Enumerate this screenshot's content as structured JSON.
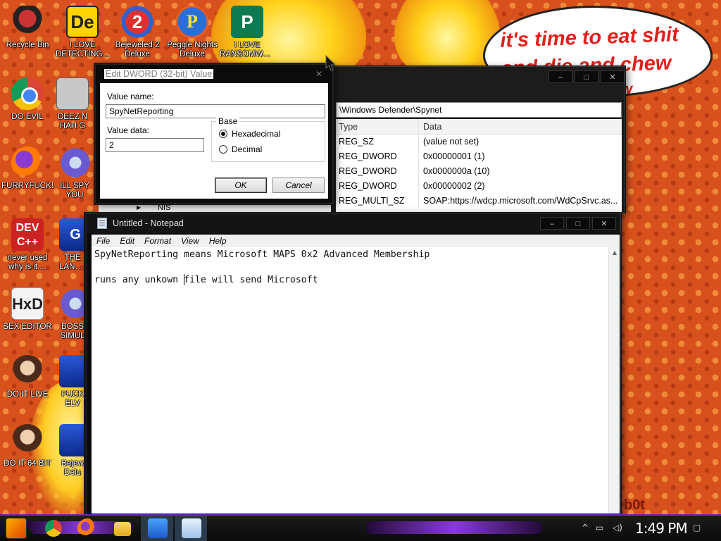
{
  "wallpaper": {
    "speech_bubble": "it's time to eat shit and die and chew",
    "bubble_tail_text": "w",
    "corner_tag": "b0t"
  },
  "desktop_icons": [
    {
      "label": "Recycle Bin",
      "icon": "recycle-bin-icon"
    },
    {
      "label": "I LOVE DETECTING...",
      "icon": "detect-it-easy-icon"
    },
    {
      "label": "Bejeweled 2 Deluxe",
      "icon": "bejeweled-icon"
    },
    {
      "label": "Peggle Nights Deluxe",
      "icon": "peggle-icon"
    },
    {
      "label": "I LOVE RANSOMWARE",
      "icon": "publisher-icon"
    },
    {
      "label": "DO EVIL",
      "icon": "chrome-icon"
    },
    {
      "label": "DEEZ N HAH G",
      "icon": "blank-file-icon"
    },
    {
      "label": "FURRYFUCK!",
      "icon": "firefox-icon"
    },
    {
      "label": "ILL SPY YOU",
      "icon": "gear-icon"
    },
    {
      "label": "never used why is it ...",
      "icon": "devcpp-icon"
    },
    {
      "label": "THE LANGUA",
      "icon": "go-icon"
    },
    {
      "label": "SEX EDITOR",
      "icon": "hxd-icon"
    },
    {
      "label": "BOSS SIMUL",
      "icon": "gear-icon"
    },
    {
      "label": "DO IT LIVE",
      "icon": "portrait-icon"
    },
    {
      "label": "FUCK ELV",
      "icon": "blue-app-icon"
    },
    {
      "label": "DO IT 64 BIT",
      "icon": "portrait-64-icon"
    },
    {
      "label": "Bejew Delu",
      "icon": "bejeweled-blue-icon"
    }
  ],
  "registry_editor": {
    "path": "\\Windows Defender\\Spynet",
    "columns": [
      "Type",
      "Data"
    ],
    "rows": [
      {
        "type": "REG_SZ",
        "data": "(value not set)"
      },
      {
        "type": "REG_DWORD",
        "data": "0x00000001 (1)"
      },
      {
        "type": "REG_DWORD",
        "data": "0x0000000a (10)"
      },
      {
        "type": "REG_DWORD",
        "data": "0x00000002 (2)"
      },
      {
        "type": "REG_MULTI_SZ",
        "data": "SOAP:https://wdcp.microsoft.com/WdCpSrvc.as..."
      }
    ],
    "tree_partial_label": "NIS"
  },
  "dword_dialog": {
    "title": "Edit DWORD (32-bit) Value",
    "value_name_label": "Value name:",
    "value_name": "SpyNetReporting",
    "value_data_label": "Value data:",
    "value_data": "2",
    "base_label": "Base",
    "hex_label": "Hexadecimal",
    "dec_label": "Decimal",
    "selected_base": "Hexadecimal",
    "ok_label": "OK",
    "cancel_label": "Cancel"
  },
  "notepad": {
    "title": "Untitled - Notepad",
    "menus": [
      "File",
      "Edit",
      "Format",
      "View",
      "Help"
    ],
    "text": "SpyNetReporting means Microsoft MAPS 0x2 Advanced Membership\n\nruns any unkown file will send Microsoft"
  },
  "taskbar": {
    "clock": "1:49 PM"
  },
  "colors": {
    "wallpaper": "#d8501c",
    "bubble_text": "#e0201c",
    "taskbar_glow": "#8a3ad8"
  }
}
